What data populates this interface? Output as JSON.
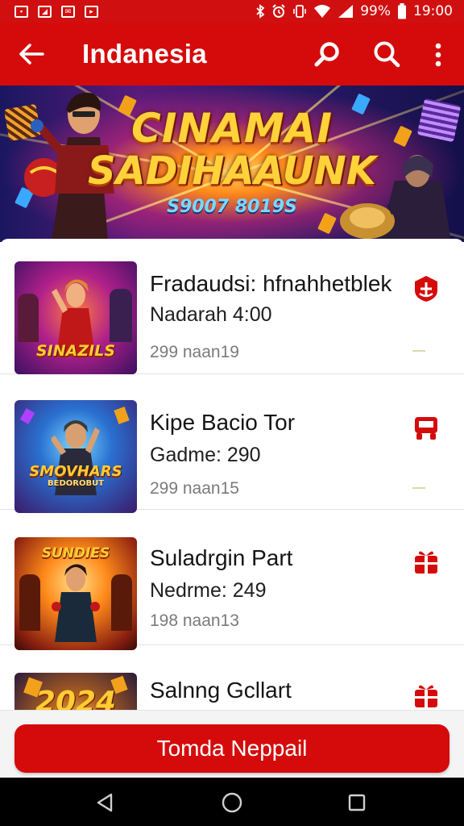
{
  "status_bar": {
    "battery_text": "99%",
    "time": "19:00"
  },
  "app_bar": {
    "title": "Indanesia",
    "icons": [
      "back-arrow-icon",
      "key-search-icon",
      "search-icon",
      "more-vert-icon"
    ]
  },
  "banner": {
    "title_line_1": "CINAMAI",
    "title_line_2": "SADIHAAUNK",
    "subtitle": "S9007 8019S"
  },
  "games": [
    {
      "title": "Fradaudsi: hfnahhetblek",
      "meta": "Nadarah 4:00",
      "count": "299 naan19",
      "thumb_label": "SINAZILS",
      "action_icon": "shield-icon"
    },
    {
      "title": "Kipe Bacio Tor",
      "meta": "Gadme: 290",
      "count": "299 naan15",
      "thumb_label": "SMOVHARS",
      "thumb_sub": "BEDOROBUT",
      "action_icon": "bus-icon"
    },
    {
      "title": "Suladrgin Part",
      "meta": "Nedrme: 249",
      "count": "198 naan13",
      "thumb_label": "SUNDIES",
      "action_icon": "gift-icon"
    },
    {
      "title": "Salnng Gcllart",
      "thumb_label": "2024",
      "action_icon": "gift-icon"
    }
  ],
  "bottom_button": {
    "label": "Tomda Neppail"
  },
  "colors": {
    "primary_red": "#d50b0b",
    "status_red": "#d01010"
  }
}
